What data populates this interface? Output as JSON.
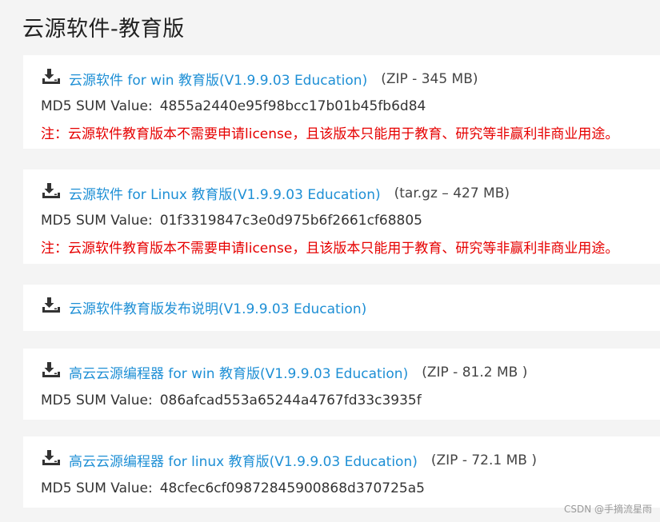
{
  "page": {
    "title": "云源软件-教育版"
  },
  "downloads": [
    {
      "link": "云源软件 for win 教育版(V1.9.9.03 Education)",
      "size": "(ZIP - 345 MB)",
      "md5_label": "MD5 SUM Value:",
      "md5_value": "4855a2440e95f98bcc17b01b45fb6d84",
      "note": "注：云源软件教育版本不需要申请license，且该版本只能用于教育、研究等非赢利非商业用途。"
    },
    {
      "link": "云源软件 for Linux 教育版(V1.9.9.03 Education)",
      "size": "(tar.gz – 427 MB)",
      "md5_label": "MD5 SUM Value:",
      "md5_value": "01f3319847c3e0d975b6f2661cf68805",
      "note": "注：云源软件教育版本不需要申请license，且该版本只能用于教育、研究等非赢利非商业用途。"
    },
    {
      "link": "云源软件教育版发布说明(V1.9.9.03 Education)"
    },
    {
      "link": "高云云源编程器 for win 教育版(V1.9.9.03 Education)",
      "size": "(ZIP - 81.2 MB )",
      "md5_label": "MD5 SUM Value:",
      "md5_value": "086afcad553a65244a4767fd33c3935f"
    },
    {
      "link": "高云云源编程器 for linux 教育版(V1.9.9.03 Education)",
      "size": "(ZIP - 72.1 MB )",
      "md5_label": "MD5 SUM Value:",
      "md5_value": "48cfec6cf09872845900868d370725a5"
    }
  ],
  "watermark": "CSDN @手摘流星雨",
  "icons": {
    "download": "download-icon"
  },
  "colors": {
    "link": "#1e8fd5",
    "note": "#e60000",
    "background": "#f4f4f4",
    "card": "#ffffff"
  }
}
